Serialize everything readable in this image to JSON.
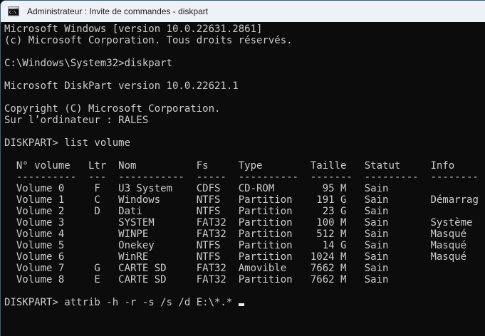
{
  "window": {
    "title": "Administrateur : Invite de commandes - diskpart",
    "icon": "cmd-icon"
  },
  "colors": {
    "console_bg": "#0c0c0c",
    "console_text": "#cccccc",
    "titlebar_bg": "#eef2f8",
    "titlebar_text": "#1b1b1b",
    "window_border": "#2f6585",
    "cursor": "#ededed"
  },
  "console": {
    "lines": [
      "Microsoft Windows [version 10.0.22631.2861]",
      "(c) Microsoft Corporation. Tous droits réservés.",
      "",
      "C:\\Windows\\System32>diskpart",
      "",
      "Microsoft DiskPart version 10.0.22621.1",
      "",
      "Copyright (C) Microsoft Corporation.",
      "Sur l’ordinateur : RALES",
      "",
      "DISKPART> list volume",
      "",
      "  N° volume   Ltr  Nom          Fs     Type        Taille   Statut     Info",
      "  ----------  ---  -----------  -----  ----------  -------  ---------  --------",
      "  Volume 0     F   U3 System    CDFS   CD-ROM        95 M   Sain",
      "  Volume 1     C   Windows      NTFS   Partition    191 G   Sain       Démarrag",
      "  Volume 2     D   Dati         NTFS   Partition     23 G   Sain",
      "  Volume 3         SYSTEM       FAT32  Partition    100 M   Sain       Système",
      "  Volume 4         WINPE        FAT32  Partition    512 M   Sain       Masqué",
      "  Volume 5         Onekey       NTFS   Partition     14 G   Sain       Masqué",
      "  Volume 6         WinRE        NTFS   Partition   1024 M   Sain       Masqué",
      "  Volume 7     G   CARTE SD     FAT32  Amovible    7662 M   Sain",
      "  Volume 8     E   CARTE SD     FAT32  Partition   7662 M   Sain",
      ""
    ],
    "prompt_line": "DISKPART> attrib -h -r -s /s /d E:\\*.* "
  },
  "volume_table": {
    "headers": [
      "N° volume",
      "Ltr",
      "Nom",
      "Fs",
      "Type",
      "Taille",
      "Statut",
      "Info"
    ],
    "rows": [
      {
        "volume": "Volume 0",
        "ltr": "F",
        "nom": "U3 System",
        "fs": "CDFS",
        "type": "CD-ROM",
        "taille": "95 M",
        "statut": "Sain",
        "info": ""
      },
      {
        "volume": "Volume 1",
        "ltr": "C",
        "nom": "Windows",
        "fs": "NTFS",
        "type": "Partition",
        "taille": "191 G",
        "statut": "Sain",
        "info": "Démarrag"
      },
      {
        "volume": "Volume 2",
        "ltr": "D",
        "nom": "Dati",
        "fs": "NTFS",
        "type": "Partition",
        "taille": "23 G",
        "statut": "Sain",
        "info": ""
      },
      {
        "volume": "Volume 3",
        "ltr": "",
        "nom": "SYSTEM",
        "fs": "FAT32",
        "type": "Partition",
        "taille": "100 M",
        "statut": "Sain",
        "info": "Système"
      },
      {
        "volume": "Volume 4",
        "ltr": "",
        "nom": "WINPE",
        "fs": "FAT32",
        "type": "Partition",
        "taille": "512 M",
        "statut": "Sain",
        "info": "Masqué"
      },
      {
        "volume": "Volume 5",
        "ltr": "",
        "nom": "Onekey",
        "fs": "NTFS",
        "type": "Partition",
        "taille": "14 G",
        "statut": "Sain",
        "info": "Masqué"
      },
      {
        "volume": "Volume 6",
        "ltr": "",
        "nom": "WinRE",
        "fs": "NTFS",
        "type": "Partition",
        "taille": "1024 M",
        "statut": "Sain",
        "info": "Masqué"
      },
      {
        "volume": "Volume 7",
        "ltr": "G",
        "nom": "CARTE SD",
        "fs": "FAT32",
        "type": "Amovible",
        "taille": "7662 M",
        "statut": "Sain",
        "info": ""
      },
      {
        "volume": "Volume 8",
        "ltr": "E",
        "nom": "CARTE SD",
        "fs": "FAT32",
        "type": "Partition",
        "taille": "7662 M",
        "statut": "Sain",
        "info": ""
      }
    ]
  }
}
